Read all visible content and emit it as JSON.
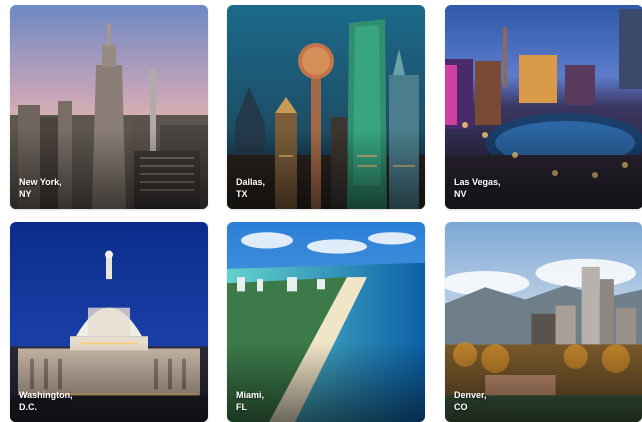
{
  "destinations": [
    {
      "city": "New York,",
      "region": "NY"
    },
    {
      "city": "Dallas,",
      "region": "TX"
    },
    {
      "city": "Las Vegas,",
      "region": "NV"
    },
    {
      "city": "Washington,",
      "region": "D.C."
    },
    {
      "city": "Miami,",
      "region": "FL"
    },
    {
      "city": "Denver,",
      "region": "CO"
    }
  ],
  "colors": {
    "caption_text": "#ffffff",
    "page_background": "#ffffff"
  }
}
